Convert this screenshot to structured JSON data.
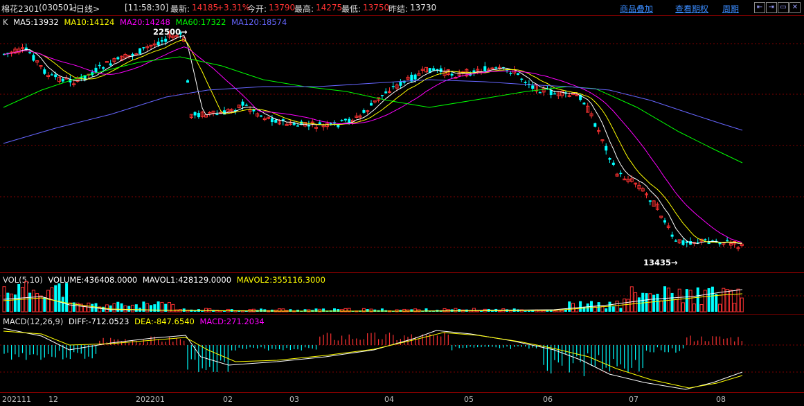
{
  "header": {
    "symbol": "棉花2301",
    "code": "(030501)",
    "period": "<日线>",
    "time": "[11:58:30]",
    "latest_label": "最新:",
    "latest_value": "14185",
    "change_pct": "+3.31%",
    "open_label": "今开:",
    "open_value": "13790",
    "high_label": "最高:",
    "high_value": "14275",
    "low_label": "最低:",
    "low_value": "13750",
    "prev_close_label": "昨结:",
    "prev_close_value": "13730",
    "btn_overlay": "商品叠加",
    "btn_futures": "查看期权",
    "btn_period": "周期"
  },
  "nav_icons": [
    "back-icon",
    "forward-icon",
    "maximize-icon",
    "close-icon"
  ],
  "price_legend": {
    "k": "K",
    "ma5": "MA5:13932",
    "ma10": "MA10:14124",
    "ma20": "MA20:14248",
    "ma60": "MA60:17322",
    "ma120": "MA120:18574"
  },
  "annotations": {
    "high": "22500",
    "high_arrow": "→",
    "low": "13435",
    "low_arrow": "→"
  },
  "vol_legend": {
    "name": "VOL(5,10)",
    "volume": "VOLUME:436408.0000",
    "mavol1": "MAVOL1:428129.0000",
    "mavol2": "MAVOL2:355116.3000"
  },
  "macd_legend": {
    "name": "MACD(12,26,9)",
    "diff": "DIFF:-712.0523",
    "dea": "DEA:-847.6540",
    "macd": "MACD:271.2034"
  },
  "x_axis_labels": [
    "202111",
    "12",
    "202201",
    "02",
    "03",
    "04",
    "05",
    "06",
    "07",
    "08"
  ],
  "colors": {
    "up": "#ff3232",
    "down": "#00ffff",
    "ma5": "#ffffff",
    "ma10": "#ffff00",
    "ma20": "#ff00ff",
    "ma60": "#00ff00",
    "ma120": "#6666ff",
    "grid": "#800000",
    "link": "#3a8cff"
  },
  "chart_data": {
    "type": "candlestick",
    "price_range_observed": [
      13435,
      22500
    ],
    "latest": 14185,
    "ma_values": {
      "MA5": 13932,
      "MA10": 14124,
      "MA20": 14248,
      "MA60": 17322,
      "MA120": 18574
    },
    "volume": {
      "VOLUME": 436408.0,
      "MAVOL1": 428129.0,
      "MAVOL2": 355116.3
    },
    "macd": {
      "DIFF": -712.0523,
      "DEA": -847.654,
      "MACD": 271.2034
    }
  }
}
